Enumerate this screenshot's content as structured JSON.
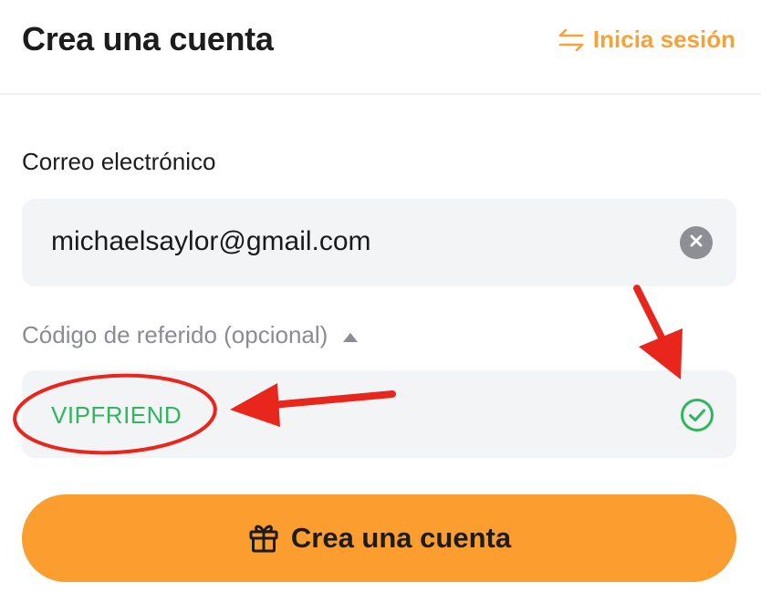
{
  "header": {
    "title": "Crea una cuenta",
    "login_link_label": "Inicia sesión",
    "login_icon": "swap-arrows-icon"
  },
  "form": {
    "email_label": "Correo electrónico",
    "email_value": "michaelsaylor@gmail.com",
    "clear_icon": "close-icon",
    "referral_label": "Código de referido (opcional)",
    "referral_toggle_icon": "caret-up-icon",
    "referral_value": "VIPFRIEND",
    "referral_status_icon": "check-circle-icon",
    "submit_label": "Crea una cuenta",
    "submit_icon": "gift-icon"
  },
  "colors": {
    "accent": "#f7a139",
    "button": "#fb9d2f",
    "success": "#2fb65e",
    "field_bg": "#f3f4f6",
    "muted_text": "#8a8c92",
    "annotation": "#e8261c"
  }
}
